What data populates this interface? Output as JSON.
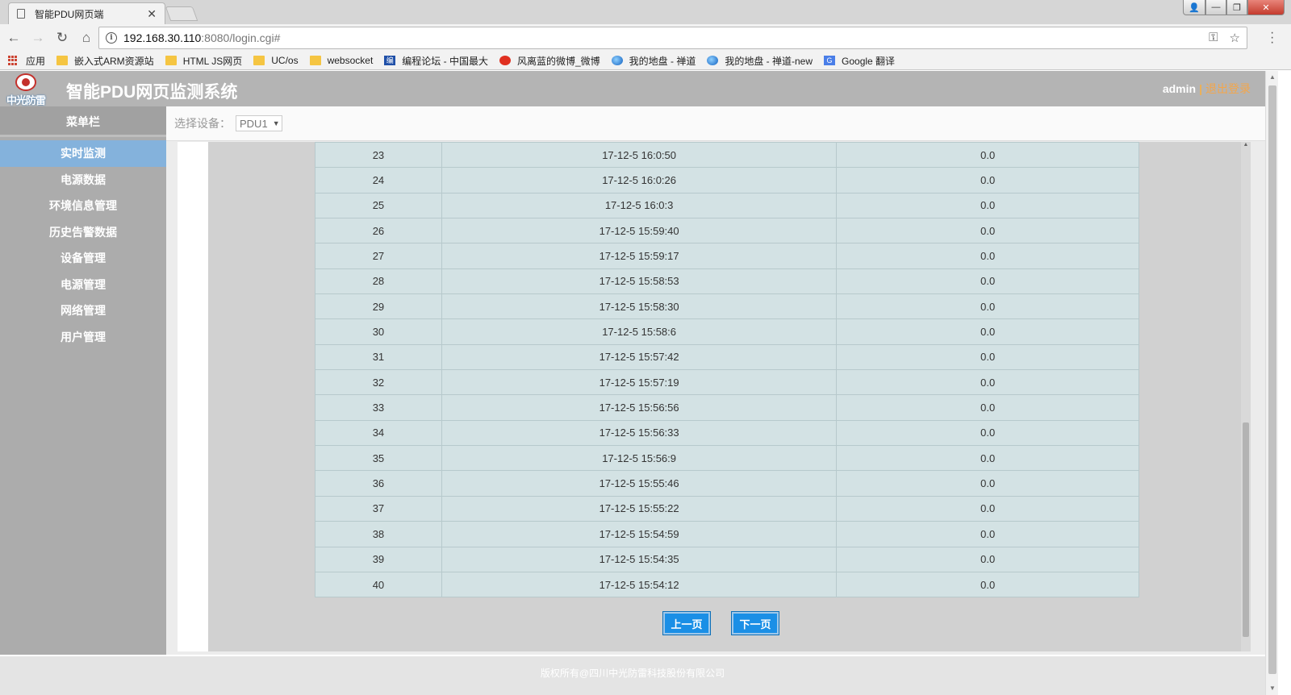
{
  "browser": {
    "tab_title": "智能PDU网页端",
    "tab_close": "✕",
    "window_controls": {
      "min": "—",
      "max": "❐",
      "close": "✕"
    },
    "url_host": "192.168.30.110",
    "url_rest": ":8080/login.cgi#",
    "bookmarks": [
      {
        "label": "应用",
        "icon": "apps-icon"
      },
      {
        "label": "嵌入式ARM资源站",
        "icon": "folder-icon"
      },
      {
        "label": "HTML JS网页",
        "icon": "folder-icon"
      },
      {
        "label": "UC/os",
        "icon": "folder-icon"
      },
      {
        "label": "websocket",
        "icon": "folder-icon"
      },
      {
        "label": "编程论坛 - 中国最大",
        "icon": "forum-icon"
      },
      {
        "label": "风离蓝的微博_微博",
        "icon": "weibo-icon"
      },
      {
        "label": "我的地盘 - 禅道",
        "icon": "globe-icon"
      },
      {
        "label": "我的地盘 - 禅道-new",
        "icon": "globe-icon"
      },
      {
        "label": "Google 翻译",
        "icon": "google-translate-icon"
      }
    ]
  },
  "app": {
    "logo_text": "中光防雷",
    "title": "智能PDU网页监测系统",
    "user": "admin",
    "separator": "|",
    "logout": "退出登录"
  },
  "sidebar": {
    "header": "菜单栏",
    "items": [
      {
        "label": "实时监测",
        "active": true
      },
      {
        "label": "电源数据",
        "active": false
      },
      {
        "label": "环境信息管理",
        "active": false
      },
      {
        "label": "历史告警数据",
        "active": false
      },
      {
        "label": "设备管理",
        "active": false
      },
      {
        "label": "电源管理",
        "active": false
      },
      {
        "label": "网络管理",
        "active": false
      },
      {
        "label": "用户管理",
        "active": false
      }
    ]
  },
  "device": {
    "label": "选择设备：",
    "selected": "PDU1"
  },
  "table": {
    "rows": [
      [
        "23",
        "17-12-5 16:0:50",
        "0.0"
      ],
      [
        "24",
        "17-12-5 16:0:26",
        "0.0"
      ],
      [
        "25",
        "17-12-5 16:0:3",
        "0.0"
      ],
      [
        "26",
        "17-12-5 15:59:40",
        "0.0"
      ],
      [
        "27",
        "17-12-5 15:59:17",
        "0.0"
      ],
      [
        "28",
        "17-12-5 15:58:53",
        "0.0"
      ],
      [
        "29",
        "17-12-5 15:58:30",
        "0.0"
      ],
      [
        "30",
        "17-12-5 15:58:6",
        "0.0"
      ],
      [
        "31",
        "17-12-5 15:57:42",
        "0.0"
      ],
      [
        "32",
        "17-12-5 15:57:19",
        "0.0"
      ],
      [
        "33",
        "17-12-5 15:56:56",
        "0.0"
      ],
      [
        "34",
        "17-12-5 15:56:33",
        "0.0"
      ],
      [
        "35",
        "17-12-5 15:56:9",
        "0.0"
      ],
      [
        "36",
        "17-12-5 15:55:46",
        "0.0"
      ],
      [
        "37",
        "17-12-5 15:55:22",
        "0.0"
      ],
      [
        "38",
        "17-12-5 15:54:59",
        "0.0"
      ],
      [
        "39",
        "17-12-5 15:54:35",
        "0.0"
      ],
      [
        "40",
        "17-12-5 15:54:12",
        "0.0"
      ]
    ]
  },
  "pagination": {
    "prev": "上一页",
    "next": "下一页"
  },
  "footer": {
    "text": "版权所有@四川中光防雷科技股份有限公司"
  }
}
